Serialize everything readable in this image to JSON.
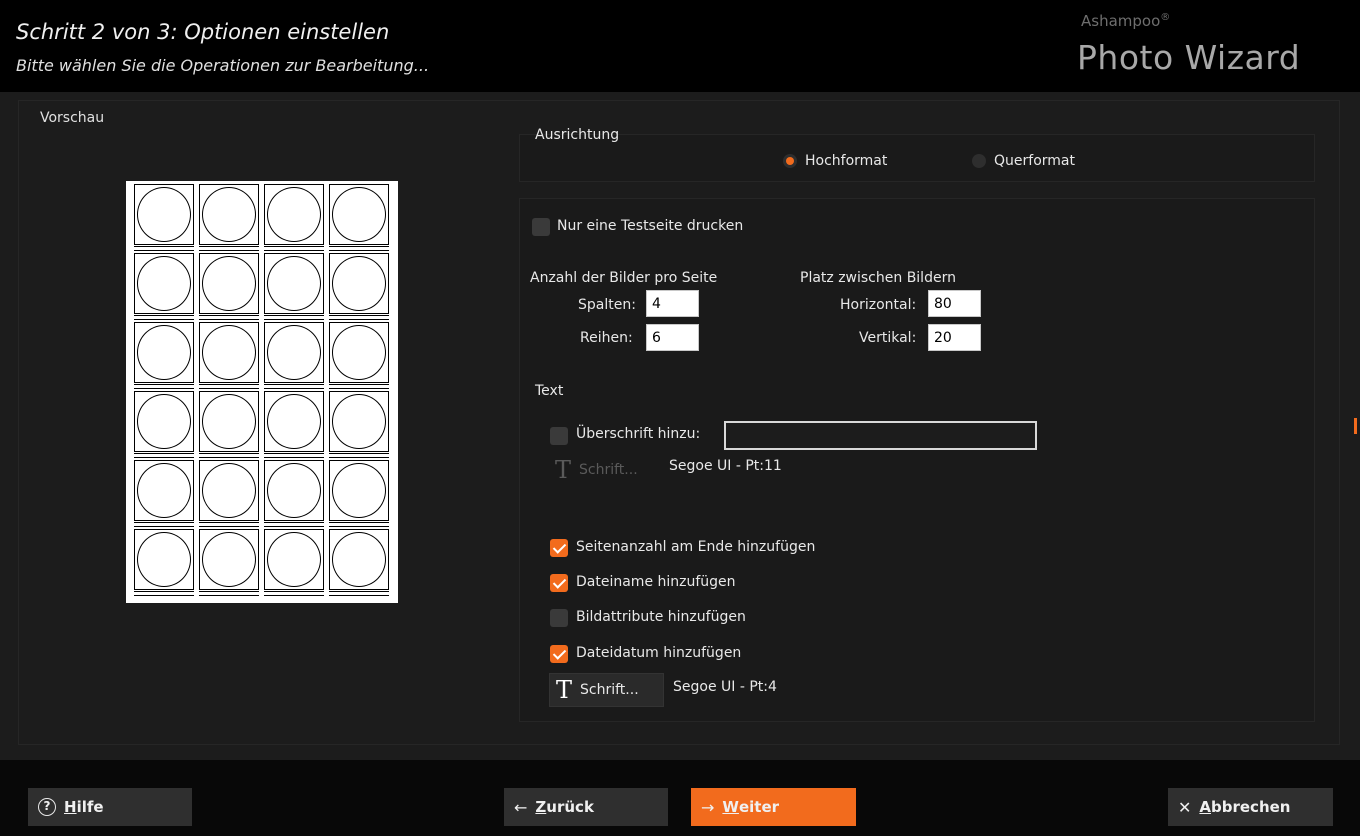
{
  "header": {
    "title": "Schritt 2 von 3: Optionen einstellen",
    "subtitle": "Bitte wählen Sie die Operationen zur Bearbeitung...",
    "brand_top": "Ashampoo",
    "brand_main": "Photo Wizard"
  },
  "preview": {
    "label": "Vorschau",
    "columns": 4,
    "rows": 6
  },
  "orientation": {
    "label": "Ausrichtung",
    "options": [
      {
        "label": "Hochformat",
        "selected": true
      },
      {
        "label": "Querformat",
        "selected": false
      }
    ]
  },
  "test_page": {
    "label": "Nur eine Testseite drucken",
    "checked": false
  },
  "images_per_page": {
    "label": "Anzahl der Bilder pro Seite",
    "columns_label": "Spalten:",
    "columns_value": "4",
    "rows_label": "Reihen:",
    "rows_value": "6"
  },
  "spacing": {
    "label": "Platz zwischen Bildern",
    "horizontal_label": "Horizontal:",
    "horizontal_value": "80",
    "vertical_label": "Vertikal:",
    "vertical_value": "20"
  },
  "text": {
    "label": "Text",
    "heading_label": "Überschrift hinzu:",
    "heading_checked": false,
    "heading_value": "",
    "heading_font_button": "Schrift...",
    "heading_font_info": "Segoe UI - Pt:11",
    "options": [
      {
        "label": "Seitenanzahl am Ende hinzufügen",
        "checked": true
      },
      {
        "label": "Dateiname hinzufügen",
        "checked": true
      },
      {
        "label": "Bildattribute hinzufügen",
        "checked": false
      },
      {
        "label": "Dateidatum hinzufügen",
        "checked": true
      }
    ],
    "font_button": "Schrift...",
    "font_info": "Segoe UI - Pt:4"
  },
  "footer": {
    "help_prefix": "H",
    "help_rest": "ilfe",
    "back_prefix": "Z",
    "back_rest": "urück",
    "next_prefix": "W",
    "next_rest": "eiter",
    "cancel_prefix": "A",
    "cancel_rest": "bbrechen"
  },
  "colors": {
    "accent": "#f26b1d",
    "background": "#1c1c1c",
    "header": "#000000"
  }
}
